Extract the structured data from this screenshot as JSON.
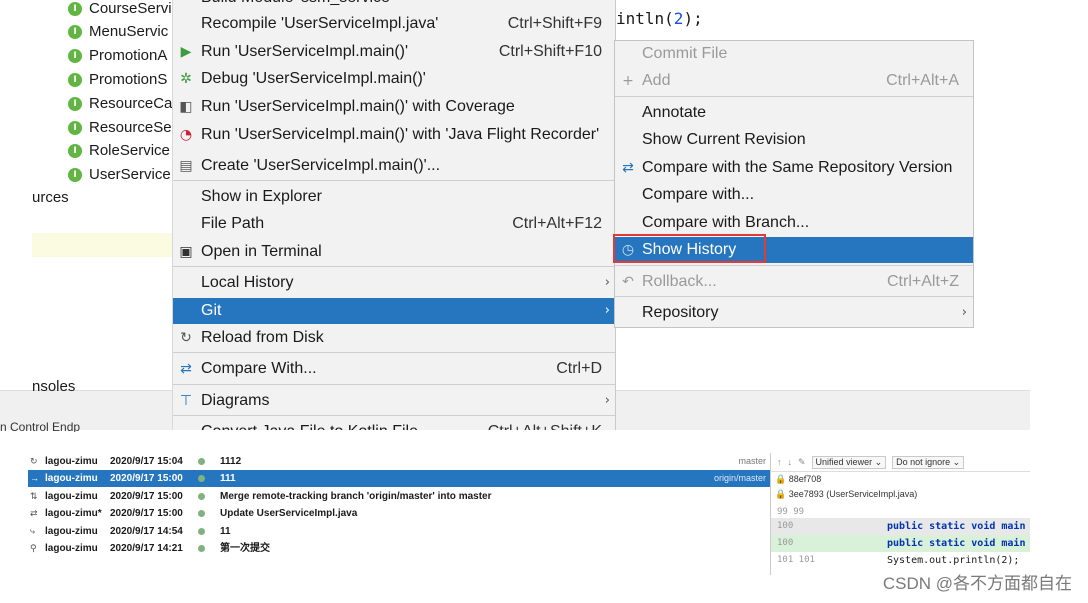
{
  "project_tree": {
    "items": [
      "CourseServi",
      "MenuServic",
      "PromotionA",
      "PromotionS",
      "ResourceCa",
      "ResourceSe",
      "RoleService",
      "UserService"
    ],
    "labels": [
      "urces",
      "nsoles"
    ]
  },
  "code": {
    "line1_text": "intln(",
    "line1_num": "2",
    "line1_end": ");"
  },
  "context_menu": {
    "items": [
      {
        "label": "Build Module 'ssm_service'",
        "shortcut": "",
        "icon": "build-icon"
      },
      {
        "label": "Recompile 'UserServiceImpl.java'",
        "shortcut": "Ctrl+Shift+F9",
        "icon": ""
      },
      {
        "label": "Run 'UserServiceImpl.main()'",
        "shortcut": "Ctrl+Shift+F10",
        "icon": "run-icon"
      },
      {
        "label": "Debug 'UserServiceImpl.main()'",
        "shortcut": "",
        "icon": "debug-icon"
      },
      {
        "label": "Run 'UserServiceImpl.main()' with Coverage",
        "shortcut": "",
        "icon": "coverage-icon"
      },
      {
        "label": "Run 'UserServiceImpl.main()' with 'Java Flight Recorder'",
        "shortcut": "",
        "icon": "profiler-icon"
      },
      {
        "label": "Create 'UserServiceImpl.main()'...",
        "shortcut": "",
        "icon": "config-icon"
      },
      {
        "label": "Show in Explorer",
        "shortcut": "",
        "icon": ""
      },
      {
        "label": "File Path",
        "shortcut": "Ctrl+Alt+F12",
        "icon": ""
      },
      {
        "label": "Open in Terminal",
        "shortcut": "",
        "icon": "terminal-icon"
      },
      {
        "label": "Local History",
        "shortcut": "",
        "icon": "",
        "submenu": true
      },
      {
        "label": "Git",
        "shortcut": "",
        "icon": "",
        "submenu": true
      },
      {
        "label": "Reload from Disk",
        "shortcut": "",
        "icon": "reload-icon"
      },
      {
        "label": "Compare With...",
        "shortcut": "Ctrl+D",
        "icon": "compare-icon"
      },
      {
        "label": "Diagrams",
        "shortcut": "",
        "icon": "diagram-icon",
        "submenu": true
      },
      {
        "label": "Convert Java File to Kotlin File",
        "shortcut": "Ctrl+Alt+Shift+K",
        "icon": ""
      }
    ]
  },
  "git_submenu": {
    "items": [
      {
        "label": "Commit File",
        "shortcut": "",
        "disabled": true
      },
      {
        "label": "Add",
        "shortcut": "Ctrl+Alt+A",
        "disabled": true
      },
      {
        "label": "Annotate",
        "shortcut": ""
      },
      {
        "label": "Show Current Revision",
        "shortcut": ""
      },
      {
        "label": "Compare with the Same Repository Version",
        "shortcut": ""
      },
      {
        "label": "Compare with...",
        "shortcut": ""
      },
      {
        "label": "Compare with Branch...",
        "shortcut": ""
      },
      {
        "label": "Show History",
        "shortcut": ""
      },
      {
        "label": "Rollback...",
        "shortcut": "Ctrl+Alt+Z",
        "disabled": true
      },
      {
        "label": "Repository",
        "shortcut": ""
      }
    ]
  },
  "toolwindow_tabs": {
    "text": "n Control     Endp"
  },
  "git_log": {
    "rows": [
      {
        "author": "lagou-zimu",
        "date": "2020/9/17 15:04",
        "message": "1112",
        "tag": "master"
      },
      {
        "author": "lagou-zimu",
        "date": "2020/9/17 15:00",
        "message": "111",
        "tag": "origin/master"
      },
      {
        "author": "lagou-zimu",
        "date": "2020/9/17 15:00",
        "message": "Merge remote-tracking branch 'origin/master' into master",
        "tag": ""
      },
      {
        "author": "lagou-zimu*",
        "date": "2020/9/17 15:00",
        "message": "Update UserServiceImpl.java",
        "tag": ""
      },
      {
        "author": "lagou-zimu",
        "date": "2020/9/17 14:54",
        "message": "11",
        "tag": ""
      },
      {
        "author": "lagou-zimu",
        "date": "2020/9/17 14:21",
        "message": "第一次提交",
        "tag": ""
      }
    ]
  },
  "diff_panel": {
    "viewer_mode": "Unified viewer",
    "ignore_mode": "Do not ignore",
    "commit1": "88ef708",
    "commit2": "3ee7893 (UserServiceImpl.java)",
    "lines": [
      {
        "num": "99  99",
        "text": ""
      },
      {
        "num": "100",
        "text": "public static void main"
      },
      {
        "num": "      100",
        "text": "public static void main"
      },
      {
        "num": "101 101",
        "text": "System.out.println(2);"
      }
    ]
  },
  "watermark": "CSDN @各不方面都自在",
  "colors": {
    "selection": "#2675bf",
    "highlight_box": "#e53935",
    "menu_bg": "#f2f2f2"
  }
}
